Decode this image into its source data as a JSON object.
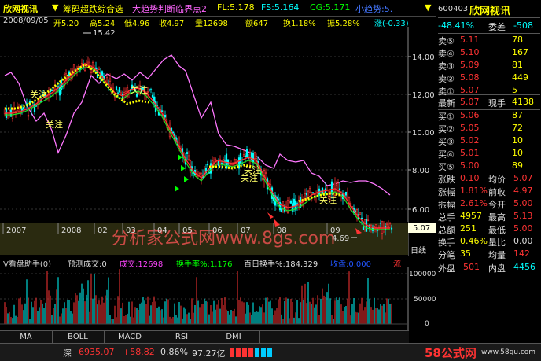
{
  "app_title": "欣网视讯",
  "indicator_line": {
    "name": "筹码超跌综合选",
    "params": [
      {
        "label": "大趋势判断临界点2",
        "color": "#ff66ff"
      },
      {
        "label": "FL:5.178",
        "color": "#ffff00"
      },
      {
        "label": "FS:5.164",
        "color": "#00ffff"
      },
      {
        "label": "CG:5.171",
        "color": "#00ff00"
      },
      {
        "label": "小趋势:5.",
        "color": "#4477ff"
      }
    ]
  },
  "quote_line": {
    "date": "2008/09/05",
    "open": "开5.20",
    "high": "高5.24",
    "low": "低4.96",
    "close": "收4.97",
    "volume": "量12698",
    "amount": "额647",
    "turnover": "换1.18%",
    "amplitude": "振5.28%",
    "change": "涨(-0.33)"
  },
  "price_axis": {
    "ticks": [
      "14.00",
      "12.00",
      "10.00",
      "8.00",
      "6.00"
    ],
    "current": "5.07"
  },
  "time_axis": {
    "labels": [
      "2007",
      "2008",
      "02",
      "03",
      "04",
      "05",
      "06",
      "07",
      "08",
      "09"
    ],
    "right_label": "日线"
  },
  "chart_annotations": {
    "high_mark": "15.42",
    "low_mark": "4.69",
    "labels": [
      "关注",
      "关注",
      "关注",
      "关注",
      "关注",
      "关注"
    ],
    "watermark": "分析家公式网www.8gs.com"
  },
  "volume_panel": {
    "header": [
      {
        "text": "V看盘助手(0)",
        "color": "#dddddd"
      },
      {
        "text": "预测成交:0",
        "color": "#dddddd"
      },
      {
        "text": "成交:12698",
        "color": "#ff44ff"
      },
      {
        "text": "换手率%:1.176",
        "color": "#00ff00"
      },
      {
        "text": "百日换手%:184.329",
        "color": "#dddddd"
      },
      {
        "text": "收盘:0.000",
        "color": "#2255ff"
      },
      {
        "text": "流",
        "color": "#ff3333"
      }
    ],
    "axis": [
      "100000",
      "50000",
      "0"
    ]
  },
  "right_panel": {
    "code": "600403",
    "name": "欣网视讯",
    "ratio_label": "委比",
    "ratio_value": "-48.41%",
    "diff_label": "委差",
    "diff_value": "-508",
    "sells": [
      {
        "label": "卖⑤",
        "price": "5.11",
        "vol": "78"
      },
      {
        "label": "卖④",
        "price": "5.10",
        "vol": "167"
      },
      {
        "label": "卖③",
        "price": "5.09",
        "vol": "81"
      },
      {
        "label": "卖②",
        "price": "5.08",
        "vol": "449"
      },
      {
        "label": "卖①",
        "price": "5.07",
        "vol": "5"
      }
    ],
    "latest_label": "最新",
    "latest_price": "5.07",
    "current_hand_label": "现手",
    "current_hand": "4138",
    "buys": [
      {
        "label": "买①",
        "price": "5.06",
        "vol": "87"
      },
      {
        "label": "买②",
        "price": "5.05",
        "vol": "72"
      },
      {
        "label": "买③",
        "price": "5.02",
        "vol": "10"
      },
      {
        "label": "买④",
        "price": "5.01",
        "vol": "10"
      },
      {
        "label": "买⑤",
        "price": "5.00",
        "vol": "89"
      }
    ],
    "stats": [
      {
        "l1": "涨跌",
        "v1": "0.10",
        "l2": "均价",
        "v2": "5.07"
      },
      {
        "l1": "涨幅",
        "v1": "1.81%",
        "l2": "前收",
        "v2": "4.97"
      },
      {
        "l1": "振幅",
        "v1": "2.61%",
        "l2": "今开",
        "v2": "5.00"
      },
      {
        "l1": "总手",
        "v1": "4957",
        "l2": "最高",
        "v2": "5.13"
      },
      {
        "l1": "总额",
        "v1": "251",
        "l2": "最低",
        "v2": "5.00"
      },
      {
        "l1": "换手",
        "v1": "0.46%",
        "l2": "量比",
        "v2": "0.00"
      },
      {
        "l1": "分笔",
        "v1": "35",
        "l2": "均量",
        "v2": "142"
      }
    ],
    "outer_label": "外盘",
    "outer_value": "501",
    "inner_label": "内盘",
    "inner_value": "4456"
  },
  "tabs": [
    "MA",
    "BOLL",
    "MACD",
    "RSI",
    "DMI"
  ],
  "status_bar": {
    "index_name": "深",
    "index_value": "6935.07",
    "index_change": "+58.82",
    "index_pct": "0.86%",
    "amount": "97.27亿",
    "brand": "58公式网",
    "brand_url": "www.58gu.com"
  },
  "colors": {
    "up": "#ff3333",
    "down": "#00ffff",
    "yellow": "#ffff00",
    "magenta": "#ff66ff",
    "green": "#00ff00"
  }
}
